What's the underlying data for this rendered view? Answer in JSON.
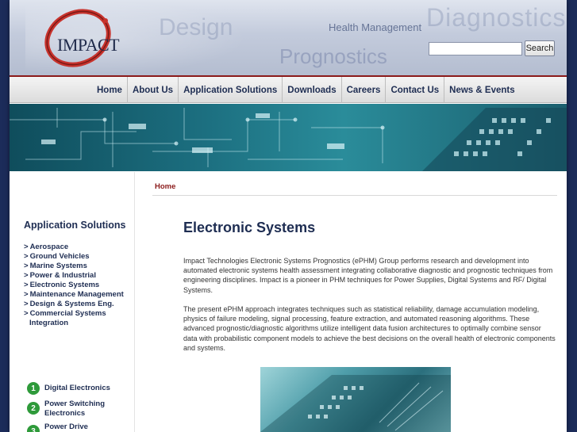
{
  "header": {
    "logo_text": "IMPACT",
    "watermarks": {
      "diagnostics": "Diagnostics",
      "design": "Design",
      "health": "Health Management",
      "prognostics": "Prognostics"
    },
    "search": {
      "value": "",
      "button_label": "Search"
    }
  },
  "nav": {
    "items": [
      {
        "label": "Home"
      },
      {
        "label": "About Us"
      },
      {
        "label": "Application Solutions"
      },
      {
        "label": "Downloads"
      },
      {
        "label": "Careers"
      },
      {
        "label": "Contact Us"
      },
      {
        "label": "News & Events"
      }
    ]
  },
  "sidebar": {
    "title": "Application Solutions",
    "items": [
      {
        "label": "Aerospace"
      },
      {
        "label": "Ground Vehicles"
      },
      {
        "label": "Marine Systems"
      },
      {
        "label": "Power & Industrial"
      },
      {
        "label": "Electronic Systems"
      },
      {
        "label": "Maintenance Management"
      },
      {
        "label": "Design & Systems Eng."
      },
      {
        "label": "Commercial Systems"
      },
      {
        "label": "Integration"
      }
    ],
    "bullet": ">",
    "numbered": [
      {
        "num": "1",
        "label": "Digital Electronics"
      },
      {
        "num": "2",
        "label": "Power Switching Electronics"
      },
      {
        "num": "3",
        "label": "Power Drive"
      }
    ]
  },
  "main": {
    "breadcrumb": "Home",
    "title": "Electronic Systems",
    "paragraphs": [
      "Impact Technologies Electronic Systems Prognostics (ePHM) Group performs research and development into automated electronic systems health assessment integrating collaborative diagnostic and prognostic techniques from engineering disciplines. Impact is a pioneer in PHM techniques for Power Supplies, Digital Systems and RF/ Digital Systems.",
      "The present ePHM approach integrates techniques such as statistical reliability, damage accumulation modeling, physics of failure modeling, signal processing, feature extraction, and automated reasoning algorithms. These advanced prognostic/diagnostic algorithms utilize intelligent data fusion architectures to optimally combine sensor data with probabilistic component models to achieve the best decisions on the overall health of electronic components and systems."
    ]
  },
  "colors": {
    "background": "#1c2c5a",
    "nav_text": "#1e2d52",
    "accent_red": "#8b1a1a",
    "number_green": "#2e9a3a"
  }
}
